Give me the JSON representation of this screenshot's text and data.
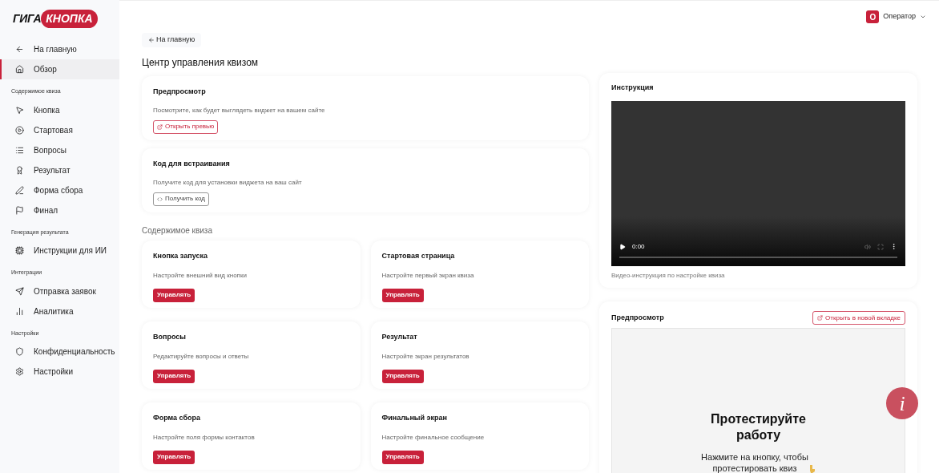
{
  "logo": {
    "left": "ГИГА",
    "right": "КНОПКА"
  },
  "sidebar": {
    "items": [
      {
        "kind": "back",
        "label": "На главную",
        "selected": false
      },
      {
        "kind": "home",
        "label": "Обзор",
        "selected": true
      }
    ],
    "sections": [
      {
        "title": "Содержимое квиза",
        "items": [
          {
            "kind": "cursor",
            "label": "Кнопка",
            "selected": false
          },
          {
            "kind": "play",
            "label": "Стартовая",
            "selected": false
          },
          {
            "kind": "list",
            "label": "Вопросы",
            "selected": false
          },
          {
            "kind": "award",
            "label": "Результат",
            "selected": false
          },
          {
            "kind": "pen",
            "label": "Форма сбора",
            "selected": false
          },
          {
            "kind": "flag",
            "label": "Финал",
            "selected": false
          }
        ]
      },
      {
        "title": "Генерация результата",
        "items": [
          {
            "kind": "cpu",
            "label": "Инструкции для ИИ",
            "selected": false
          }
        ]
      },
      {
        "title": "Интеграции",
        "items": [
          {
            "kind": "send",
            "label": "Отправка заявок",
            "selected": false
          },
          {
            "kind": "chart",
            "label": "Аналитика",
            "selected": false
          }
        ]
      },
      {
        "title": "Настройки",
        "items": [
          {
            "kind": "shield",
            "label": "Конфиденциальность",
            "selected": false
          },
          {
            "kind": "gear",
            "label": "Настройки",
            "selected": false
          }
        ]
      }
    ]
  },
  "user": {
    "initial": "О",
    "name": "Оператор"
  },
  "back_button": "На главную",
  "page_title": "Центр управления квизом",
  "tools": [
    {
      "kind": "preview",
      "title": "Предпросмотр",
      "description": "Посмотрите, как будет выглядеть виджет на вашем сайте",
      "button": "Открыть превью"
    },
    {
      "kind": "code",
      "title": "Код для встраивания",
      "description": "Получите код для установки виджета на ваш сайт",
      "button": "Получить код"
    }
  ],
  "content_heading": "Содержимое квиза",
  "content_cards": [
    {
      "title": "Кнопка запуска",
      "description": "Настройте внешний вид кнопки",
      "button": "Управлять"
    },
    {
      "title": "Стартовая страница",
      "description": "Настройте первый экран квиза",
      "button": "Управлять"
    },
    {
      "title": "Вопросы",
      "description": "Редактируйте вопросы и ответы",
      "button": "Управлять"
    },
    {
      "title": "Результат",
      "description": "Настройте экран результатов",
      "button": "Управлять"
    },
    {
      "title": "Форма сбора",
      "description": "Настройте поля формы контактов",
      "button": "Управлять"
    },
    {
      "title": "Финальный экран",
      "description": "Настройте финальное сообщение",
      "button": "Управлять"
    }
  ],
  "instruction": {
    "title": "Инструкция",
    "video_time": "0:00",
    "caption": "Видео-инструкция по настройке квиза"
  },
  "preview": {
    "title": "Предпросмотр",
    "button": "Открыть в новой вкладке",
    "heading": "Протестируйте работу",
    "text": "Нажмите на кнопку, чтобы протестировать квиз"
  },
  "info_button": "i"
}
